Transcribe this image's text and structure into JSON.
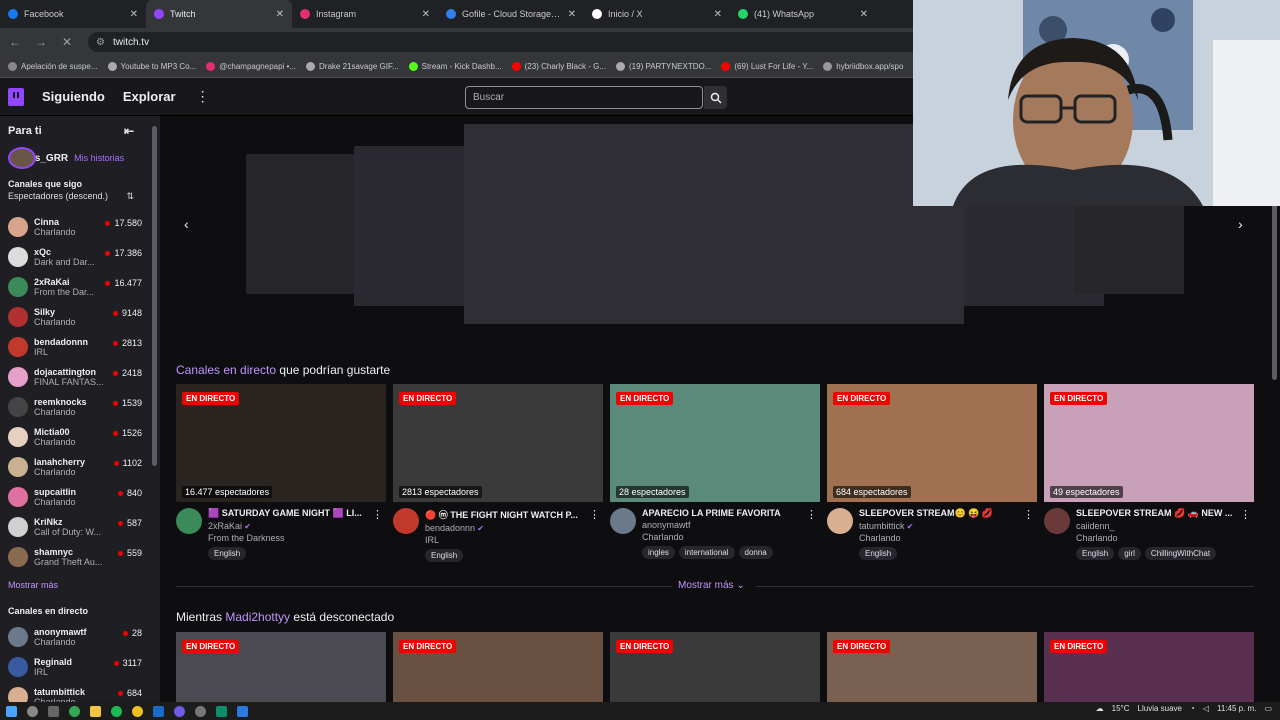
{
  "browser": {
    "tabs": [
      {
        "title": "Facebook",
        "color": "#1877f2",
        "active": false
      },
      {
        "title": "Twitch",
        "color": "#9147ff",
        "active": true
      },
      {
        "title": "Instagram",
        "color": "#e1306c",
        "active": false
      },
      {
        "title": "Gofile - Cloud Storage Mad",
        "color": "#2f80ed",
        "active": false
      },
      {
        "title": "Inicio / X",
        "color": "#ffffff",
        "active": false
      },
      {
        "title": "(41) WhatsApp",
        "color": "#25d366",
        "active": false
      }
    ],
    "url": "twitch.tv",
    "bookmarks": [
      "Apelación de suspe...",
      "Youtube to MP3 Co...",
      "@champagnepapi •...",
      "Drake 21savage GIF...",
      "Stream - Kick Dashb...",
      "(23) Charly Black - G...",
      "(19) PARTYNEXTDO...",
      "(69) Lust For Life - Y...",
      "hybriidbox.app/spo"
    ]
  },
  "topnav": {
    "following": "Siguiendo",
    "browse": "Explorar",
    "search_placeholder": "Buscar"
  },
  "sidebar": {
    "header": "Para ti",
    "stories_user": "Jabes_GRR",
    "stories_label": "Mis historias",
    "followed_title": "Canales que sigo",
    "sort_label": "Espectadores (descend.)",
    "followed": [
      {
        "name": "Cinna",
        "game": "Charlando",
        "viewers": "17.580",
        "color": "#d8a48c"
      },
      {
        "name": "xQc",
        "game": "Dark and Dar...",
        "viewers": "17.386",
        "color": "#dcdcdc"
      },
      {
        "name": "2xRaKai",
        "game": "From the Dar...",
        "viewers": "16.477",
        "color": "#3b8a5a"
      },
      {
        "name": "Silky",
        "game": "Charlando",
        "viewers": "9148",
        "color": "#b03030"
      },
      {
        "name": "bendadonnn",
        "game": "IRL",
        "viewers": "2813",
        "color": "#c0392b"
      },
      {
        "name": "dojacattington",
        "game": "FINAL FANTAS...",
        "viewers": "2418",
        "color": "#e4a0c8"
      },
      {
        "name": "reemknocks",
        "game": "Charlando",
        "viewers": "1539",
        "color": "#444"
      },
      {
        "name": "Mictia00",
        "game": "Charlando",
        "viewers": "1526",
        "color": "#e8d0c0"
      },
      {
        "name": "lanahcherry",
        "game": "Charlando",
        "viewers": "1102",
        "color": "#c8b090"
      },
      {
        "name": "supcaitlin",
        "game": "Charlando",
        "viewers": "840",
        "color": "#e070a0"
      },
      {
        "name": "KriNkz",
        "game": "Call of Duty: W...",
        "viewers": "587",
        "color": "#d0d0d0"
      },
      {
        "name": "shamnyc",
        "game": "Grand Theft Au...",
        "viewers": "559",
        "color": "#8a6a50"
      }
    ],
    "show_more": "Mostrar más",
    "live_title": "Canales en directo",
    "live": [
      {
        "name": "anonymawtf",
        "game": "Charlando",
        "viewers": "28",
        "color": "#6a7a8a"
      },
      {
        "name": "Reginald",
        "game": "IRL",
        "viewers": "3117",
        "color": "#3a5aa0"
      },
      {
        "name": "tatumbittick",
        "game": "Charlando",
        "viewers": "684",
        "color": "#d8b090"
      }
    ]
  },
  "main": {
    "row1_highlight": "Canales en directo",
    "row1_rest": " que podrían gustarte",
    "live_badge": "EN DIRECTO",
    "cards": [
      {
        "viewers": "16.477 espectadores",
        "title": "🟪 SATURDAY GAME NIGHT 🟪 LI...",
        "user": "2xRaKai",
        "verified": true,
        "game": "From the Darkness",
        "tags": [
          "English"
        ],
        "thumb": "#2a2420",
        "avatar": "#3b8a5a"
      },
      {
        "viewers": "2813 espectadores",
        "title": "🔴 ⓜ THE FIGHT NIGHT WATCH P...",
        "user": "bendadonnn",
        "verified": true,
        "game": "IRL",
        "tags": [
          "English"
        ],
        "thumb": "#3a3a3a",
        "avatar": "#c0392b"
      },
      {
        "viewers": "28 espectadores",
        "title": "APARECIO LA PRIME FAVORITA",
        "user": "anonymawtf",
        "verified": false,
        "game": "Charlando",
        "tags": [
          "ingles",
          "international",
          "donna"
        ],
        "thumb": "#5a8a7a",
        "avatar": "#6a7a8a"
      },
      {
        "viewers": "684 espectadores",
        "title": "SLEEPOVER STREAM😊 😝 💋",
        "user": "tatumbittick",
        "verified": true,
        "game": "Charlando",
        "tags": [
          "English"
        ],
        "thumb": "#a07050",
        "avatar": "#d8b090"
      },
      {
        "viewers": "49 espectadores",
        "title": "SLEEPOVER STREAM 💋 🚗 NEW ...",
        "user": "caiidenn_",
        "verified": false,
        "game": "Charlando",
        "tags": [
          "English",
          "girl",
          "ChillingWithChat"
        ],
        "thumb": "#c8a0b8",
        "avatar": "#6a3a3a"
      }
    ],
    "show_more": "Mostrar más",
    "row2_prefix": "Mientras ",
    "row2_highlight": "Madi2hottyy",
    "row2_rest": " está desconectado",
    "row2_thumbs": [
      "#4a4a50",
      "#6a5040",
      "#3a3a3a",
      "#7a6050",
      "#5a3050"
    ]
  },
  "taskbar": {
    "temperature": "15°C",
    "weather": "Lluvia suave",
    "time": "11:45 p. m."
  }
}
